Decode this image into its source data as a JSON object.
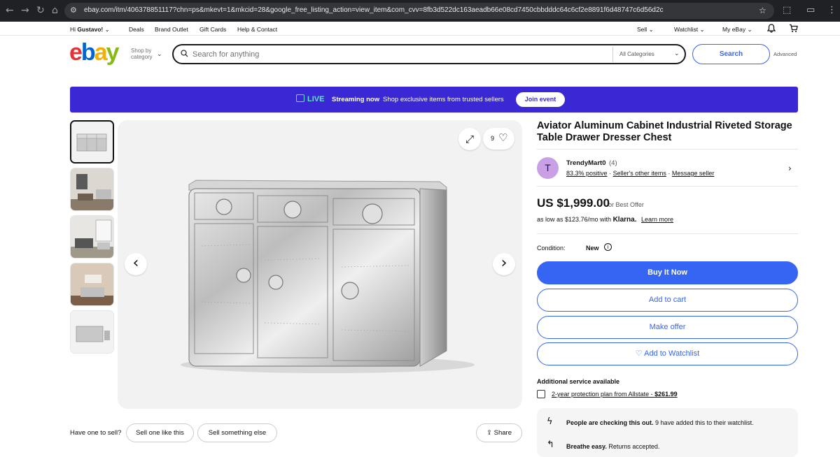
{
  "browser": {
    "url": "ebay.com/itm/406378851117?chn=ps&mkevt=1&mkcid=28&google_free_listing_action=view_item&com_cvv=8fb3d522dc163aeadb66e08cd7450cbbdddc64c6cf2e8891f6d48747c6d56d2c",
    "back_icon": "←",
    "forward_icon": "→",
    "reload_icon": "↻",
    "home_icon": "⌂",
    "tune_icon": "⚙",
    "star_icon": "☆",
    "ext_icon": "⬚",
    "cast_icon": "▭",
    "menu_icon": "⋮"
  },
  "topnav": {
    "greeting_prefix": "Hi ",
    "user": "Gustavo!",
    "greeting_chev": "⌄",
    "links": [
      "Deals",
      "Brand Outlet",
      "Gift Cards",
      "Help & Contact"
    ],
    "sell": "Sell",
    "watchlist": "Watchlist",
    "myebay": "My eBay",
    "chev": "⌄",
    "bell_icon": "🔔",
    "cart_icon": "🛒"
  },
  "header": {
    "logo": {
      "e": "e",
      "b": "b",
      "a": "a",
      "y": "y"
    },
    "shop_by_1": "Shop by",
    "shop_by_2": "category",
    "shop_chev": "⌄",
    "search_icon": "⌕",
    "search_placeholder": "Search for anything",
    "category": "All Categories",
    "category_chev": "⌄",
    "search_button": "Search",
    "advanced": "Advanced"
  },
  "banner": {
    "live": "LIVE",
    "streaming": "Streaming now",
    "shop_text": "Shop exclusive items from trusted sellers",
    "join": "Join event",
    "colors": {
      "bg": "#3a28d4",
      "live": "#5fe8c7"
    }
  },
  "gallery": {
    "expand_icon": "⤢",
    "watch_count": "9",
    "heart_icon": "♡",
    "prev_icon": "‹",
    "next_icon": "›"
  },
  "listing": {
    "title": "Aviator Aluminum Cabinet Industrial Riveted Storage Table Drawer Dresser Chest",
    "seller": {
      "avatar_letter": "T",
      "name": "TrendyMart0",
      "count": "(4)",
      "positive": "83.3% positive",
      "other_items": "Seller's other items",
      "message": "Message seller",
      "sep": "·",
      "chev": "›"
    },
    "price": "US $1,999.00",
    "or_best": "or Best Offer",
    "klarna_prefix": "as low as $123.76/mo with",
    "klarna_brand": "Klarna.",
    "learn_more": "Learn more",
    "condition_label": "Condition:",
    "condition_value": "New",
    "condition_info": "i",
    "buy_now": "Buy It Now",
    "add_to_cart": "Add to cart",
    "make_offer": "Make offer",
    "add_watchlist": "♡ Add to Watchlist",
    "additional_service": "Additional service available",
    "protection_prefix": "2-year protection plan from Allstate - ",
    "protection_price": "$261.99",
    "checking_bold": "People are checking this out.",
    "checking_rest": " 9 have added this to their watchlist.",
    "checking_icon": "ϟ",
    "breathe_bold": "Breathe easy.",
    "breathe_rest": " Returns accepted.",
    "breathe_icon": "↰"
  },
  "sell_bar": {
    "have_one": "Have one to sell?",
    "sell_like": "Sell one like this",
    "sell_else": "Sell something else",
    "share": "Share",
    "share_icon": "⇪"
  }
}
